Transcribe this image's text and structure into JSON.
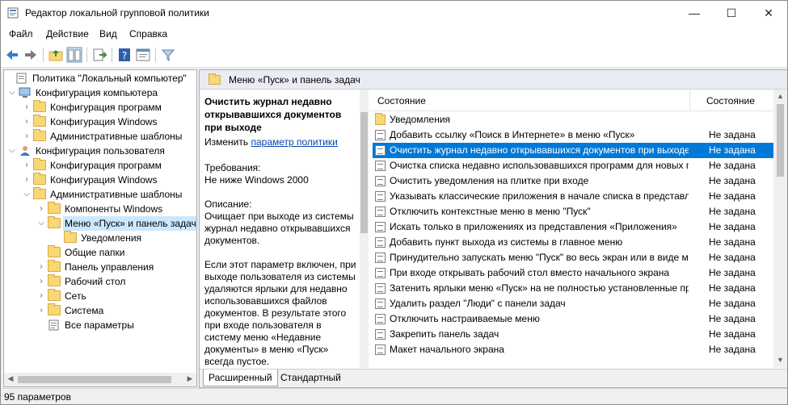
{
  "window": {
    "title": "Редактор локальной групповой политики",
    "minimize": "—",
    "maximize": "☐",
    "close": "✕"
  },
  "menu": [
    "Файл",
    "Действие",
    "Вид",
    "Справка"
  ],
  "toolbar_icons": [
    "back-arrow-icon",
    "forward-arrow-icon",
    "up-folder-icon",
    "show-hide-tree-icon",
    "export-list-icon",
    "help-icon",
    "properties-icon",
    "filter-icon"
  ],
  "tree": [
    {
      "label": "Политика \"Локальный компьютер\"",
      "depth": 0,
      "icon": "policy-icon",
      "arrow": ""
    },
    {
      "label": "Конфигурация компьютера",
      "depth": 1,
      "icon": "computer-icon",
      "arrow": "expanded"
    },
    {
      "label": "Конфигурация программ",
      "depth": 2,
      "icon": "folder-icon",
      "arrow": "collapsed"
    },
    {
      "label": "Конфигурация Windows",
      "depth": 2,
      "icon": "folder-icon",
      "arrow": "collapsed"
    },
    {
      "label": "Административные шаблоны",
      "depth": 2,
      "icon": "folder-icon",
      "arrow": "collapsed"
    },
    {
      "label": "Конфигурация пользователя",
      "depth": 1,
      "icon": "user-icon",
      "arrow": "expanded"
    },
    {
      "label": "Конфигурация программ",
      "depth": 2,
      "icon": "folder-icon",
      "arrow": "collapsed"
    },
    {
      "label": "Конфигурация Windows",
      "depth": 2,
      "icon": "folder-icon",
      "arrow": "collapsed"
    },
    {
      "label": "Административные шаблоны",
      "depth": 2,
      "icon": "folder-icon",
      "arrow": "expanded"
    },
    {
      "label": "Компоненты Windows",
      "depth": 3,
      "icon": "folder-icon",
      "arrow": "collapsed"
    },
    {
      "label": "Меню «Пуск» и панель задач",
      "depth": 3,
      "icon": "folder-icon",
      "arrow": "expanded",
      "selected": true
    },
    {
      "label": "Уведомления",
      "depth": 4,
      "icon": "folder-icon",
      "arrow": ""
    },
    {
      "label": "Общие папки",
      "depth": 3,
      "icon": "folder-icon",
      "arrow": ""
    },
    {
      "label": "Панель управления",
      "depth": 3,
      "icon": "folder-icon",
      "arrow": "collapsed"
    },
    {
      "label": "Рабочий стол",
      "depth": 3,
      "icon": "folder-icon",
      "arrow": "collapsed"
    },
    {
      "label": "Сеть",
      "depth": 3,
      "icon": "folder-icon",
      "arrow": "collapsed"
    },
    {
      "label": "Система",
      "depth": 3,
      "icon": "folder-icon",
      "arrow": "collapsed"
    },
    {
      "label": "Все параметры",
      "depth": 3,
      "icon": "all-settings-icon",
      "arrow": ""
    }
  ],
  "right_header": "Меню «Пуск» и панель задач",
  "description": {
    "title": "Очистить журнал недавно открывавшихся документов при выходе",
    "edit_prefix": "Изменить ",
    "edit_link": "параметр политики",
    "requirements_label": "Требования:",
    "requirements_value": "Не ниже Windows 2000",
    "description_label": "Описание:",
    "description_text": "Очищает при выходе из системы журнал недавно открывавшихся документов.",
    "details_text": "Если этот параметр включен, при выходе пользователя из системы удаляются ярлыки для недавно использовавшихся файлов документов. В результате этого при входе пользователя в систему меню «Недавние документы» в меню «Пуск» всегда пустое."
  },
  "list": {
    "col_name": "Состояние",
    "col_state": "Состояние",
    "rows": [
      {
        "name": "Уведомления",
        "state": "",
        "icon": "folder-icon"
      },
      {
        "name": "Добавить ссылку «Поиск в Интернете» в меню «Пуск»",
        "state": "Не задана",
        "icon": "policy-setting-icon"
      },
      {
        "name": "Очистить журнал недавно открывавшихся документов при выходе",
        "state": "Не задана",
        "icon": "policy-setting-icon",
        "selected": true
      },
      {
        "name": "Очистка списка недавно использовавшихся программ для новых пользователей",
        "state": "Не задана",
        "icon": "policy-setting-icon"
      },
      {
        "name": "Очистить уведомления на плитке при входе",
        "state": "Не задана",
        "icon": "policy-setting-icon"
      },
      {
        "name": "Указывать классические приложения в начале списка в представлении",
        "state": "Не задана",
        "icon": "policy-setting-icon"
      },
      {
        "name": "Отключить контекстные меню в меню \"Пуск\"",
        "state": "Не задана",
        "icon": "policy-setting-icon"
      },
      {
        "name": "Искать только в приложениях из представления «Приложения»",
        "state": "Не задана",
        "icon": "policy-setting-icon"
      },
      {
        "name": "Добавить пункт выхода из системы в главное меню",
        "state": "Не задана",
        "icon": "policy-setting-icon"
      },
      {
        "name": "Принудительно запускать меню \"Пуск\" во весь экран или в виде меню",
        "state": "Не задана",
        "icon": "policy-setting-icon"
      },
      {
        "name": "При входе открывать рабочий стол вместо начального экрана",
        "state": "Не задана",
        "icon": "policy-setting-icon"
      },
      {
        "name": "Затенить ярлыки меню «Пуск» на не полностью установленные программы",
        "state": "Не задана",
        "icon": "policy-setting-icon"
      },
      {
        "name": "Удалить раздел \"Люди\" с панели задач",
        "state": "Не задана",
        "icon": "policy-setting-icon"
      },
      {
        "name": "Отключить настраиваемые меню",
        "state": "Не задана",
        "icon": "policy-setting-icon"
      },
      {
        "name": "Закрепить панель задач",
        "state": "Не задана",
        "icon": "policy-setting-icon"
      },
      {
        "name": "Макет начального экрана",
        "state": "Не задана",
        "icon": "policy-setting-icon"
      }
    ]
  },
  "tabs": [
    "Расширенный",
    "Стандартный"
  ],
  "status": "95 параметров"
}
